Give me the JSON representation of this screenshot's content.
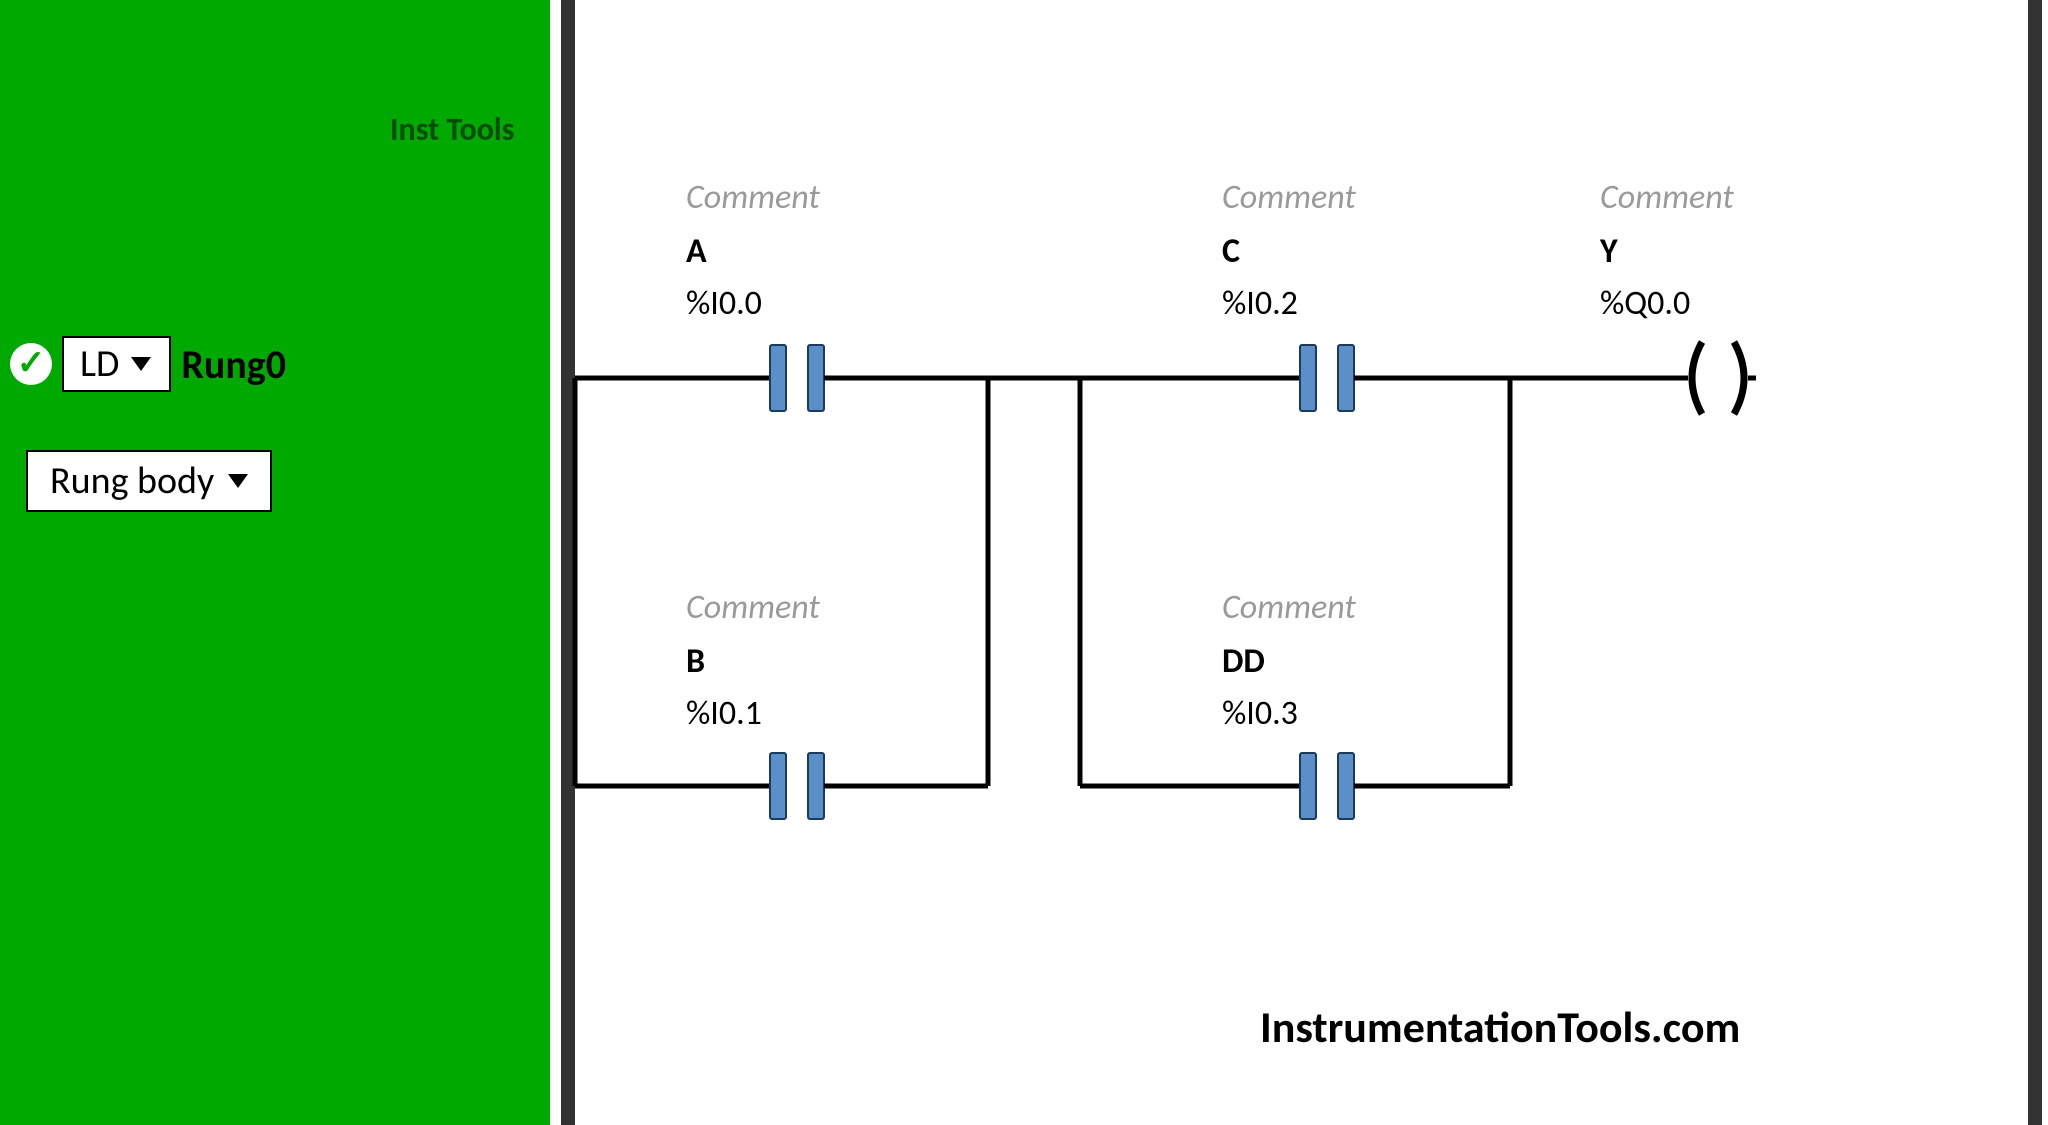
{
  "sidebar": {
    "watermark_small": "Inst Tools",
    "ld_select_label": "LD",
    "rung_title": "Rung0",
    "rung_body_label": "Rung body"
  },
  "ladder": {
    "elements": {
      "A": {
        "comment": "Comment",
        "name": "A",
        "address": "%I0.0"
      },
      "B": {
        "comment": "Comment",
        "name": "B",
        "address": "%I0.1"
      },
      "C": {
        "comment": "Comment",
        "name": "C",
        "address": "%I0.2"
      },
      "DD": {
        "comment": "Comment",
        "name": "DD",
        "address": "%I0.3"
      },
      "Y": {
        "comment": "Comment",
        "name": "Y",
        "address": "%Q0.0"
      }
    }
  },
  "watermark": "InstrumentationTools.com"
}
